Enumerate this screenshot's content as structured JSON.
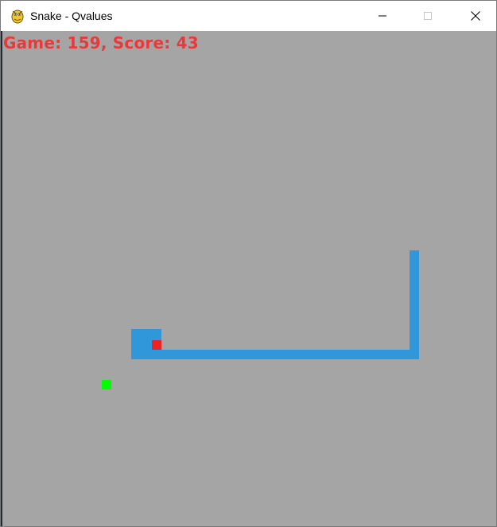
{
  "window": {
    "title": "Snake - Qvalues",
    "icon": "pygame-snake-icon"
  },
  "hud": {
    "text": "Game: 159, Score: 43",
    "game": 159,
    "score": 43
  },
  "colors": {
    "background": "#a5a5a5",
    "snake": "#3097db",
    "snake_head": "#ee2222",
    "food": "#00ff00",
    "hud_text": "#e83a3a"
  }
}
